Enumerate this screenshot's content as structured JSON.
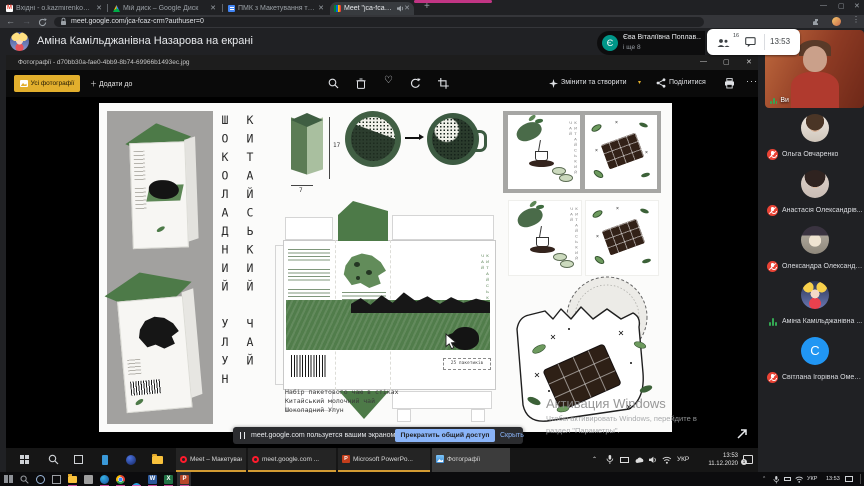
{
  "browser": {
    "tabs": [
      {
        "label": "Вхідні - o.kazmirenko@kubgu...",
        "icon": "gmail-icon"
      },
      {
        "label": "Мій диск – Google Диск",
        "icon": "drive-icon"
      },
      {
        "label": "ПМК з Макетування та роботи...",
        "icon": "docs-icon"
      },
      {
        "label": "Meet \"jca-fcaz-crm\"",
        "icon": "meet-icon",
        "active": true
      }
    ],
    "url": "meet.google.com/jca-fcaz-crm?authuser=0"
  },
  "meet": {
    "presenter_banner": "Аміна Камільджанівна Назарова на екрані",
    "pill": {
      "initial": "Є",
      "line1": "Єва Віталіївна Поплав...",
      "line2": "і ще 8"
    },
    "people_count": "16",
    "clock": "13:53"
  },
  "photos": {
    "window_title": "Фотографії - d70bb30a-fae0-4bb9-8b74-69966b1493ec.jpg",
    "all_photos": "Усі фотографії",
    "add_to": "Додати до",
    "edit_create": "Змінити та створити",
    "share": "Поділитися"
  },
  "design": {
    "title_col1": "ШОКОЛАДНИЙ УЛУН",
    "title_col2": "КИТАЙСЬКИЙ ЧАЙ",
    "dim_height": "17",
    "dim_width": "7",
    "panel_caption": "КИТАЙСЬКИЙ ЧАЙ",
    "pack_label": "25 пакетиків",
    "caption": [
      "Набір пакетового чаю в стіках",
      "Китайський молочний чай",
      "Шоколадний Улун"
    ]
  },
  "share_bar": {
    "message": "meet.google.com пользуется вашим экраном.",
    "stop": "Прекратить общий доступ",
    "hide": "Скрыть"
  },
  "watermark": {
    "line1": "Активация Windows",
    "line2": "Чтобы активировать Windows, перейдите в",
    "line3": "раздел \"Параметры\"."
  },
  "presenter_taskbar": {
    "windows": [
      "Meet – Макетуван...",
      "meet.google.com ...",
      "Microsoft PowerPo...",
      "Фотографії"
    ],
    "lang": "УКР",
    "time": "13:53",
    "date": "11.12.2020",
    "badge": "1"
  },
  "local_taskbar": {
    "lang": "УКР",
    "time": "13:53"
  },
  "sidebar": {
    "self_label": "Ви",
    "participants": [
      {
        "name": "Ольга Овчаренко",
        "muted": true
      },
      {
        "name": "Анастасія Олександрів...",
        "muted": true
      },
      {
        "name": "Олександра Олександр...",
        "muted": true
      },
      {
        "name": "Аміна Камільджанівна ...",
        "muted": false
      },
      {
        "name": "Світлана Ігорівна Омел...",
        "muted": true,
        "initial": "С"
      }
    ]
  }
}
